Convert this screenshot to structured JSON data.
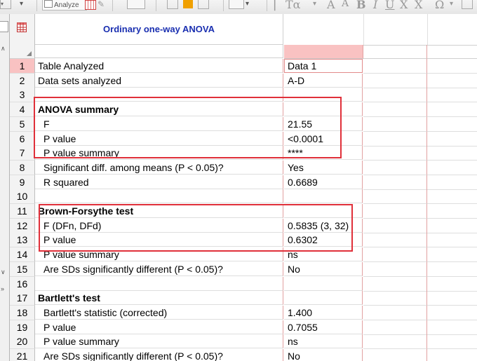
{
  "toolbar": {
    "analyze_label": "Analyze",
    "glyph_a1": "A",
    "glyph_a2": "A",
    "glyph_b": "B",
    "glyph_u": "U",
    "glyph_x": "X",
    "glyph_x2": "X",
    "glyph_omega": "Ω",
    "glyph_ta": "Tα"
  },
  "sheet": {
    "title": "Ordinary one-way ANOVA"
  },
  "rows": [
    {
      "num": "1",
      "label": "Table Analyzed",
      "value": "Data 1"
    },
    {
      "num": "2",
      "label": "Data sets analyzed",
      "value": "A-D"
    },
    {
      "num": "3",
      "label": "",
      "value": ""
    },
    {
      "num": "4",
      "label": "ANOVA summary",
      "value": ""
    },
    {
      "num": "5",
      "label": "F",
      "value": "21.55"
    },
    {
      "num": "6",
      "label": "P value",
      "value": "<0.0001"
    },
    {
      "num": "7",
      "label": "P value summary",
      "value": "****"
    },
    {
      "num": "8",
      "label": "Significant diff. among means (P < 0.05)?",
      "value": "Yes"
    },
    {
      "num": "9",
      "label": "R squared",
      "value": "0.6689"
    },
    {
      "num": "10",
      "label": "",
      "value": ""
    },
    {
      "num": "11",
      "label": "Brown-Forsythe test",
      "value": ""
    },
    {
      "num": "12",
      "label": "F (DFn, DFd)",
      "value": "0.5835 (3, 32)"
    },
    {
      "num": "13",
      "label": "P value",
      "value": "0.6302"
    },
    {
      "num": "14",
      "label": "P value summary",
      "value": "ns"
    },
    {
      "num": "15",
      "label": "Are SDs significantly different (P < 0.05)?",
      "value": "No"
    },
    {
      "num": "16",
      "label": "",
      "value": ""
    },
    {
      "num": "17",
      "label": "Bartlett's test",
      "value": ""
    },
    {
      "num": "18",
      "label": "Bartlett's statistic (corrected)",
      "value": "1.400"
    },
    {
      "num": "19",
      "label": "P value",
      "value": "0.7055"
    },
    {
      "num": "20",
      "label": "P value summary",
      "value": "ns"
    },
    {
      "num": "21",
      "label": "Are SDs significantly different (P < 0.05)?",
      "value": "No"
    }
  ],
  "colors": {
    "title": "#1a2fb0",
    "selected_header": "#f9c2c2",
    "annotation": "#e0303a"
  }
}
